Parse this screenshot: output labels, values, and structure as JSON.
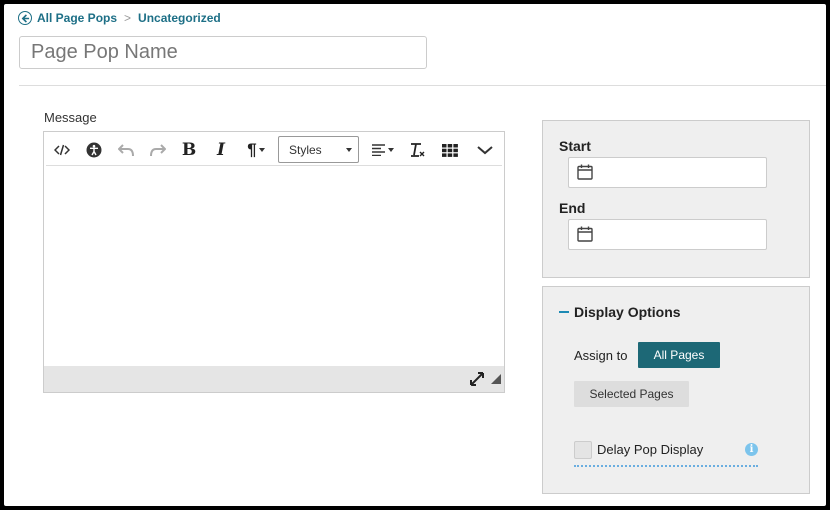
{
  "breadcrumb": {
    "back_label": "All Page Pops",
    "separator": ">",
    "current": "Uncategorized"
  },
  "name_field": {
    "placeholder": "Page Pop Name",
    "value": ""
  },
  "message": {
    "label": "Message"
  },
  "toolbar": {
    "buttons": [
      "code-icon",
      "accessibility-icon",
      "undo-icon",
      "redo-icon",
      "bold-icon",
      "italic-icon",
      "paragraph-icon",
      "align-icon",
      "clear-format-icon",
      "table-icon",
      "more-icon"
    ],
    "styles_label": "Styles"
  },
  "dates": {
    "start_label": "Start",
    "start_value": "",
    "end_label": "End",
    "end_value": ""
  },
  "display_options": {
    "title": "Display Options",
    "assign_label": "Assign to",
    "all_pages_label": "All Pages",
    "selected_pages_label": "Selected Pages",
    "delay_label": "Delay Pop Display",
    "info_glyph": "i"
  },
  "colors": {
    "link": "#1d6f86",
    "primary_button": "#1d6876",
    "accent": "#1d8ab4",
    "info": "#7cc4ec"
  }
}
